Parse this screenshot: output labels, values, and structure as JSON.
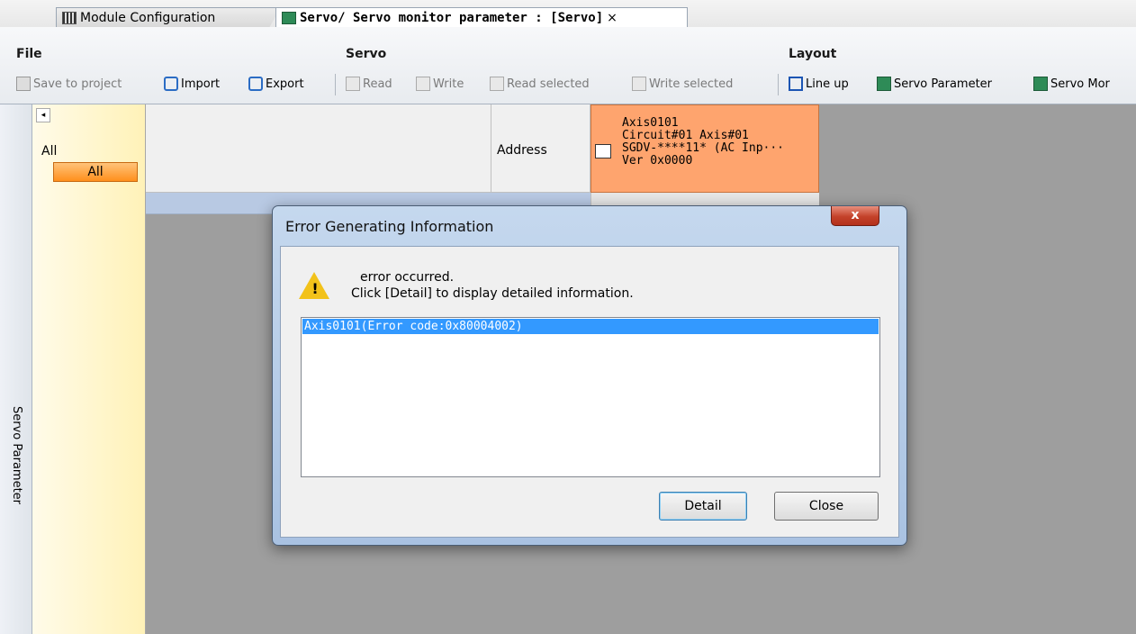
{
  "tabs": [
    {
      "label": "Module Configuration",
      "icon": "module-grid-icon",
      "active": false
    },
    {
      "label": "Servo/ Servo monitor parameter : [Servo]",
      "icon": "servo-parameter-icon",
      "active": true,
      "close": "×"
    }
  ],
  "ribbon": {
    "file": {
      "title": "File",
      "save": "Save to project",
      "import": "Import",
      "export": "Export"
    },
    "servo": {
      "title": "Servo",
      "read": "Read",
      "write": "Write",
      "read_selected": "Read selected",
      "write_selected": "Write selected"
    },
    "layout": {
      "title": "Layout",
      "line_up": "Line up",
      "servo_parameter": "Servo Parameter",
      "servo_monitor": "Servo Mor"
    }
  },
  "side": {
    "vertical_label": "Servo Parameter",
    "collapse": "◂"
  },
  "filter": {
    "label": "All",
    "button": "All"
  },
  "grid": {
    "address_header": "Address",
    "axis": {
      "line1": "Axis0101",
      "line2": "Circuit#01 Axis#01",
      "line3": "SGDV-****11* (AC Inp···",
      "line4": "Ver 0x0000"
    }
  },
  "dialog": {
    "title": "Error Generating Information",
    "close_glyph": "x",
    "message_line1": "error occurred.",
    "message_line2": "Click [Detail] to display detailed information.",
    "errors": [
      "Axis0101(Error code:0x80004002)"
    ],
    "detail_button": "Detail",
    "close_button": "Close",
    "warning_mark": "!"
  },
  "colors": {
    "axis_header": "#fea46e",
    "filter_button": "#ff9f3a",
    "selection": "#3399ff"
  }
}
